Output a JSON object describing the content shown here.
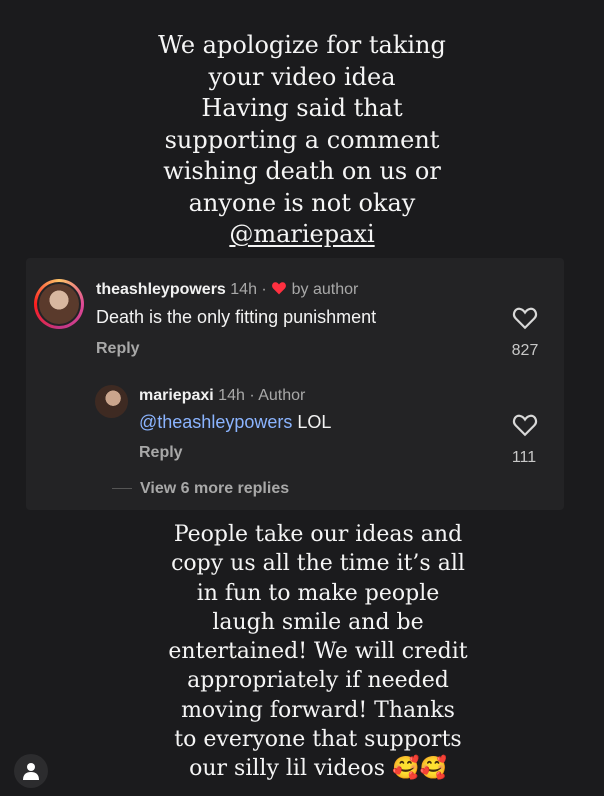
{
  "top_caption": {
    "lines": [
      "We apologize for taking",
      "your video idea",
      "Having said that",
      "supporting  a comment",
      "wishing death on us or",
      "anyone is not okay"
    ],
    "mention": "@mariepaxi"
  },
  "comments": [
    {
      "username": "theashleypowers",
      "time": "14h ·",
      "badge": "by author",
      "text": "Death is the only fitting punishment",
      "reply_label": "Reply",
      "likes": "827"
    },
    {
      "username": "mariepaxi",
      "time": "14h · Author",
      "mention": "@theashleypowers",
      "text": " LOL",
      "reply_label": "Reply",
      "likes": "111"
    }
  ],
  "view_more": "View 6 more replies",
  "bottom_caption": {
    "lines": [
      "People take our ideas and",
      "copy us all the time it’s all",
      "in fun to make people",
      "laugh smile and be",
      "entertained! We will credit",
      "appropriately if needed",
      "moving forward! Thanks",
      "to everyone that supports",
      "our silly lil videos 🥰🥰"
    ]
  },
  "colors": {
    "background": "#1b1b1d",
    "card": "#232325",
    "link": "#8bb4ff",
    "heart_badge": "#ff3040"
  },
  "icons": [
    "heart-icon",
    "person-icon"
  ]
}
